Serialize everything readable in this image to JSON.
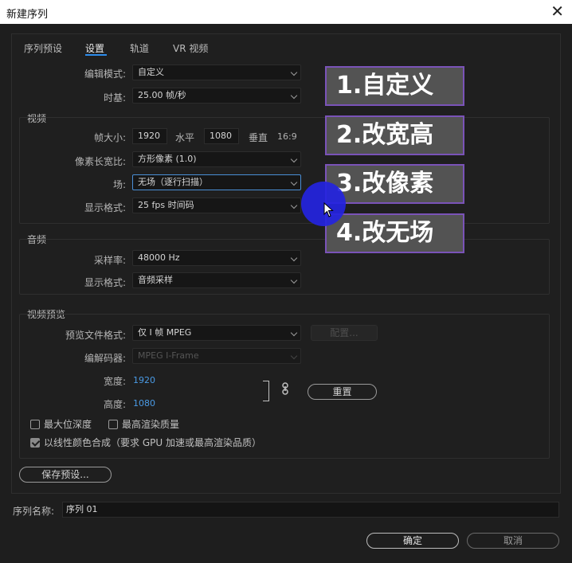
{
  "window": {
    "title": "新建序列",
    "close_glyph": "✕"
  },
  "tabs": [
    {
      "label": "序列预设",
      "active": false
    },
    {
      "label": "设置",
      "active": true
    },
    {
      "label": "轨道",
      "active": false
    },
    {
      "label": "VR 视频",
      "active": false
    }
  ],
  "settings": {
    "edit_mode_label": "编辑模式:",
    "edit_mode_value": "自定义",
    "timebase_label": "时基:",
    "timebase_value": "25.00  帧/秒"
  },
  "video": {
    "section_title": "视频",
    "frame_size_label": "帧大小:",
    "width_value": "1920",
    "horizontal_label": "水平",
    "height_value": "1080",
    "vertical_label": "垂直",
    "aspect": "16:9",
    "pixel_aspect_label": "像素长宽比:",
    "pixel_aspect_value": "方形像素 (1.0)",
    "fields_label": "场:",
    "fields_value": "无场（逐行扫描）",
    "display_format_label": "显示格式:",
    "display_format_value": "25 fps 时间码"
  },
  "audio": {
    "section_title": "音频",
    "sample_rate_label": "采样率:",
    "sample_rate_value": "48000 Hz",
    "display_format_label": "显示格式:",
    "display_format_value": "音频采样"
  },
  "video_preview": {
    "section_title": "视频预览",
    "preview_format_label": "预览文件格式:",
    "preview_format_value": "仅 I 帧 MPEG",
    "configure_button": "配置...",
    "codec_label": "编解码器:",
    "codec_value": "MPEG I-Frame",
    "width_label": "宽度:",
    "width_value": "1920",
    "height_label": "高度:",
    "height_value": "1080",
    "reset_button": "重置",
    "max_bit_depth_label": "最大位深度",
    "max_render_quality_label": "最高渲染质量",
    "linear_color_label": "以线性颜色合成（要求 GPU 加速或最高渲染品质）",
    "linear_color_checked": true,
    "max_bit_depth_checked": false,
    "max_render_quality_checked": false
  },
  "save_preset_button": "保存预设...",
  "sequence_name": {
    "label": "序列名称:",
    "value": "序列 01"
  },
  "footer": {
    "ok_button": "确定",
    "cancel_button": "取消"
  },
  "annotations": [
    {
      "label": "1.自定义"
    },
    {
      "label": "2.改宽高"
    },
    {
      "label": "3.改像素"
    },
    {
      "label": "4.改无场"
    }
  ],
  "colors": {
    "accent": "#2d8ceb",
    "value_blue": "#4a9be6",
    "annotation_border": "#7a53b8",
    "cursor_highlight": "#2424e0"
  }
}
